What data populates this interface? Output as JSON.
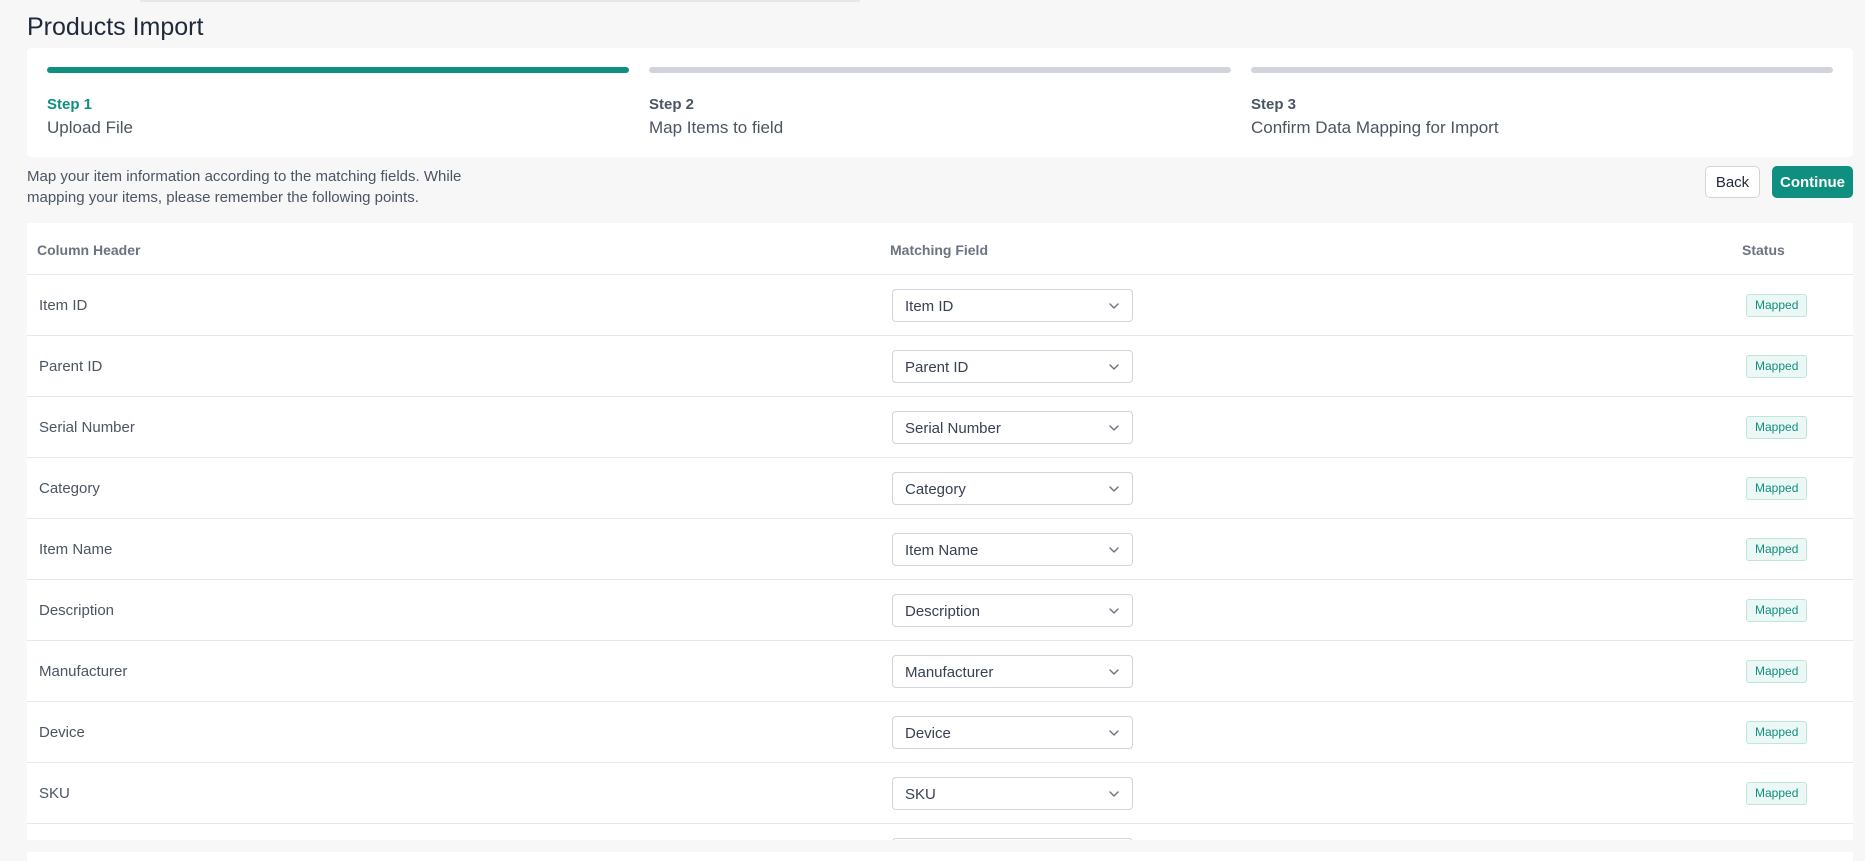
{
  "page": {
    "title": "Products Import"
  },
  "steps": [
    {
      "number": "Step 1",
      "name": "Upload File",
      "active": true
    },
    {
      "number": "Step 2",
      "name": "Map Items to field",
      "active": false
    },
    {
      "number": "Step 3",
      "name": "Confirm Data Mapping for Import",
      "active": false
    }
  ],
  "intro": {
    "text": "Map your item information according to the matching fields. While mapping your items, please remember the following points."
  },
  "actions": {
    "back_label": "Back",
    "continue_label": "Continue"
  },
  "table": {
    "columns": {
      "header": "Column Header",
      "matching": "Matching Field",
      "status": "Status"
    },
    "rows": [
      {
        "header": "Item ID",
        "field": "Item ID",
        "status": "Mapped"
      },
      {
        "header": "Parent ID",
        "field": "Parent ID",
        "status": "Mapped"
      },
      {
        "header": "Serial Number",
        "field": "Serial Number",
        "status": "Mapped"
      },
      {
        "header": "Category",
        "field": "Category",
        "status": "Mapped"
      },
      {
        "header": "Item Name",
        "field": "Item Name",
        "status": "Mapped"
      },
      {
        "header": "Description",
        "field": "Description",
        "status": "Mapped"
      },
      {
        "header": "Manufacturer",
        "field": "Manufacturer",
        "status": "Mapped"
      },
      {
        "header": "Device",
        "field": "Device",
        "status": "Mapped"
      },
      {
        "header": "SKU",
        "field": "SKU",
        "status": "Mapped"
      }
    ]
  },
  "colors": {
    "accent": "#0f8f7f",
    "badge_bg": "#ecf8f5",
    "inactive_step": "#d1d5db"
  },
  "icons": {
    "select_chevron": "chevron-down-icon"
  }
}
